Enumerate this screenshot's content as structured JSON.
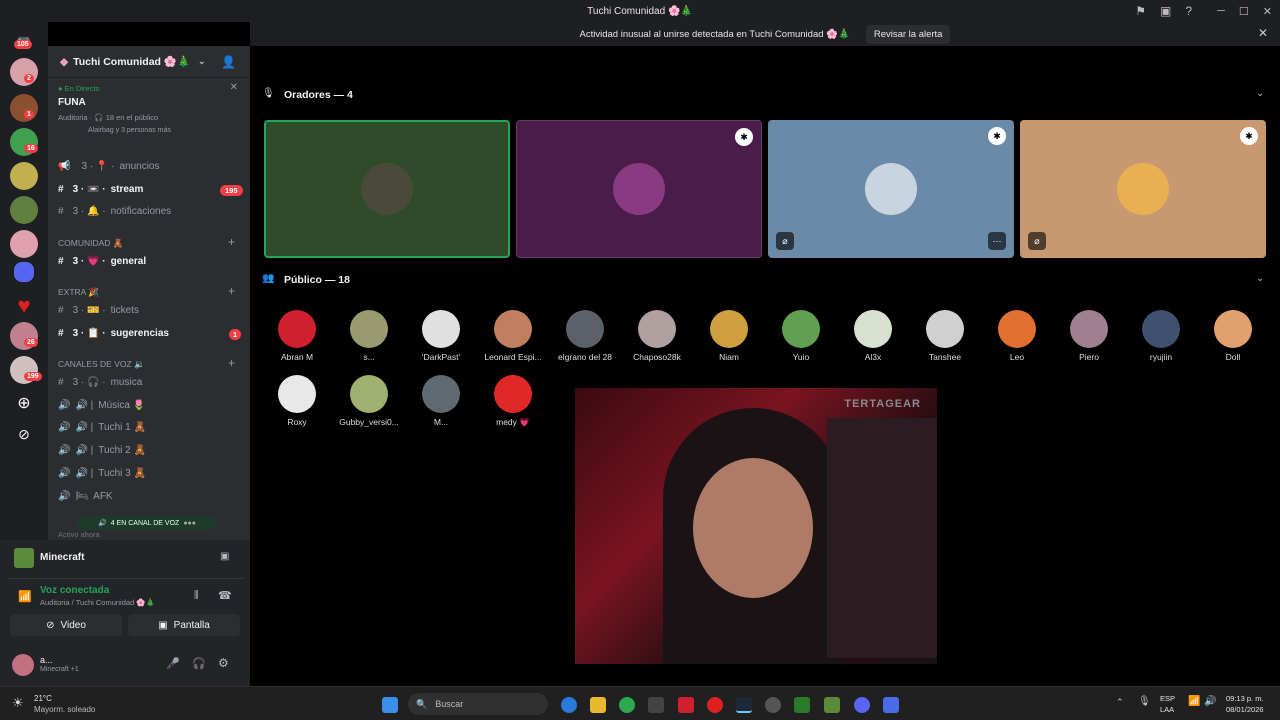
{
  "window": {
    "title": "Tuchi Comunidad 🌸🎄"
  },
  "alert": {
    "text": "Actividad inusual al unirse detectada en Tuchi Comunidad 🌸🎄",
    "action": "Revisar la alerta"
  },
  "guild_badges": {
    "top": "105",
    "g1": "2",
    "g2": "1",
    "g3": "16",
    "g4": "26",
    "g5": "199"
  },
  "server": {
    "name": "Tuchi Comunidad 🌸🎄"
  },
  "live": {
    "status": "En Directo",
    "title": "FUNA",
    "meta": "Auditoria · 🎧 18 en el público",
    "people": "Alairbag y 3 personas más"
  },
  "channels": {
    "anuncios": "anuncios",
    "stream": "stream",
    "stream_badge": "195",
    "notificaciones": "notificaciones",
    "cat_comunidad": "COMUNIDAD 🧸",
    "general": "general",
    "cat_extra": "EXTRA 🎉",
    "tickets": "tickets",
    "sugerencias": "sugerencias",
    "sugerencias_badge": "1",
    "cat_voz": "CANALES DE VOZ 🔉",
    "musica": "musica",
    "v_musica": "Música 🌷",
    "v_tuchi1": "Tuchi 1 🧸",
    "v_tuchi2": "Tuchi 2 🧸",
    "v_tuchi3": "Tuchi 3 🧸",
    "afk": "AFK",
    "voice_pill": "4 EN CANAL DE VOZ",
    "active": "Activo ahora"
  },
  "activity": {
    "game": "Minecraft"
  },
  "voice": {
    "status": "Voz conectada",
    "location": "Auditoria / Tuchi Comunidad 🌸🎄",
    "video_btn": "Video",
    "screen_btn": "Pantalla"
  },
  "user": {
    "name": "a...",
    "status": "Minecraft +1"
  },
  "speakers": {
    "header": "Oradores — 4"
  },
  "audience": {
    "header": "Público — 18",
    "members": [
      "Abran M",
      "s...",
      "'DarkPast'",
      "Leonard Espi...",
      "elgrano del 28",
      "Chaposo28k",
      "Niam",
      "Yuio",
      "Al3x",
      "Tanshee",
      "Leo",
      "Piero",
      "ryujiin",
      "Doll",
      "Roxy",
      "Gubby_versi0...",
      "M...",
      "medy 💗"
    ]
  },
  "video": {
    "brand": "TERTAGEAR"
  },
  "taskbar": {
    "weather_temp": "21°C",
    "weather_text": "Mayorm. soleado",
    "search": "Buscar",
    "lang1": "ESP",
    "lang2": "LAA",
    "time": "09:13 p. m.",
    "date": "08/01/2026"
  },
  "colors": {
    "accent": "#5865f2",
    "live": "#23a55a",
    "danger": "#f23f43",
    "bg_sidebar": "#2b2d31"
  }
}
